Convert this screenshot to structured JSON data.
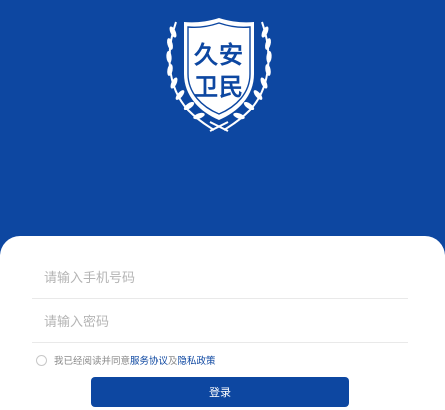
{
  "colors": {
    "brand_blue": "#0d47a1",
    "card_bg": "#ffffff",
    "placeholder": "#b4b4b4",
    "divider": "#e9e9e9"
  },
  "logo": {
    "line1": "久安",
    "line2": "卫民",
    "icon": "shield-laurel-emblem"
  },
  "form": {
    "phone_placeholder": "请输入手机号码",
    "password_placeholder": "请输入密码"
  },
  "agreement": {
    "prefix": "我已经阅读并同意",
    "service_link": "服务协议",
    "and": "及",
    "privacy_link": "隐私政策"
  },
  "login_label": "登录"
}
